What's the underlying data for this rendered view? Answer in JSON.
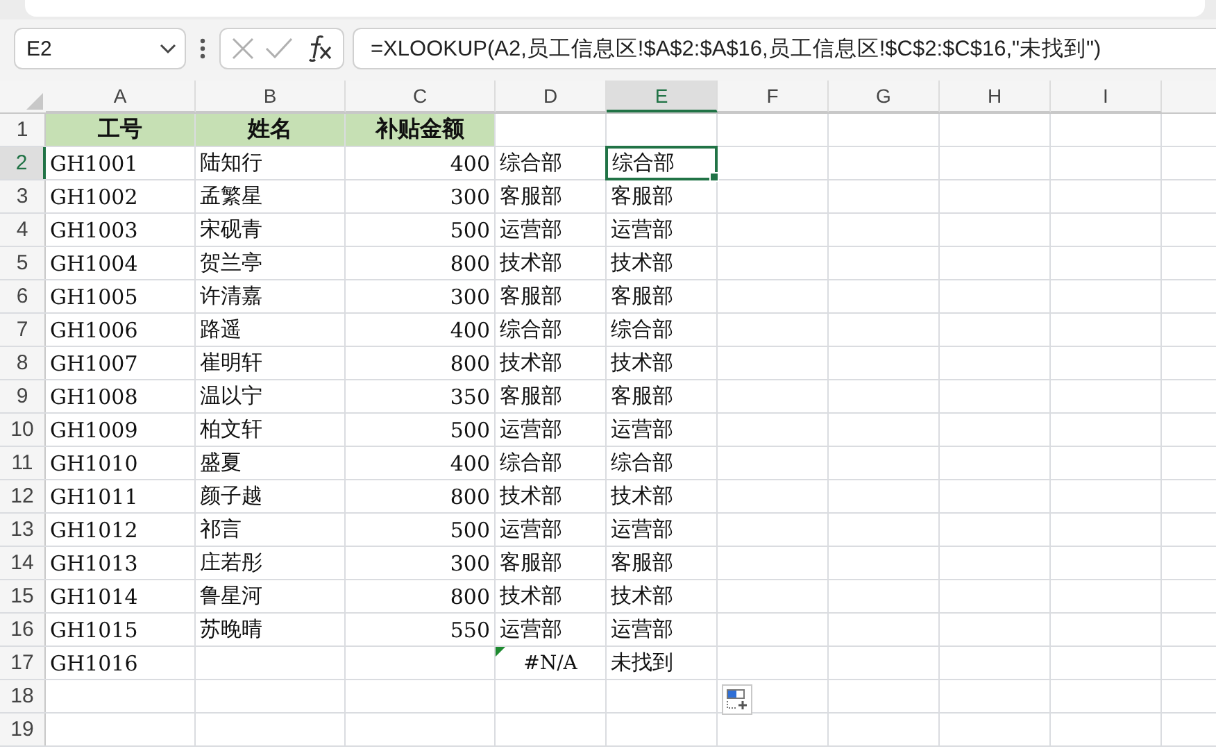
{
  "name_box": "E2",
  "formula": "=XLOOKUP(A2,员工信息区!$A$2:$A$16,员工信息区!$C$2:$C$16,\"未找到\")",
  "columns": [
    {
      "label": "A",
      "selected": false
    },
    {
      "label": "B",
      "selected": false
    },
    {
      "label": "C",
      "selected": false
    },
    {
      "label": "D",
      "selected": false
    },
    {
      "label": "E",
      "selected": true
    },
    {
      "label": "F",
      "selected": false
    },
    {
      "label": "G",
      "selected": false
    },
    {
      "label": "H",
      "selected": false
    },
    {
      "label": "I",
      "selected": false
    }
  ],
  "rows": [
    {
      "label": "1",
      "selected": false,
      "cells": [
        {
          "text": "工号",
          "kind": "header",
          "selected": false
        },
        {
          "text": "姓名",
          "kind": "header",
          "selected": false
        },
        {
          "text": "补贴金额",
          "kind": "header",
          "selected": false
        },
        null,
        null
      ]
    },
    {
      "label": "2",
      "selected": true,
      "cells": [
        {
          "text": "GH1001",
          "kind": "text",
          "selected": false
        },
        {
          "text": "陆知行",
          "kind": "text",
          "selected": false
        },
        {
          "text": "400",
          "kind": "number",
          "selected": false
        },
        {
          "text": "综合部",
          "kind": "text",
          "selected": false
        },
        {
          "text": "综合部",
          "kind": "text",
          "selected": true
        }
      ]
    },
    {
      "label": "3",
      "selected": false,
      "cells": [
        {
          "text": "GH1002",
          "kind": "text",
          "selected": false
        },
        {
          "text": "孟繁星",
          "kind": "text",
          "selected": false
        },
        {
          "text": "300",
          "kind": "number",
          "selected": false
        },
        {
          "text": "客服部",
          "kind": "text",
          "selected": false
        },
        {
          "text": "客服部",
          "kind": "text",
          "selected": false
        }
      ]
    },
    {
      "label": "4",
      "selected": false,
      "cells": [
        {
          "text": "GH1003",
          "kind": "text",
          "selected": false
        },
        {
          "text": "宋砚青",
          "kind": "text",
          "selected": false
        },
        {
          "text": "500",
          "kind": "number",
          "selected": false
        },
        {
          "text": "运营部",
          "kind": "text",
          "selected": false
        },
        {
          "text": "运营部",
          "kind": "text",
          "selected": false
        }
      ]
    },
    {
      "label": "5",
      "selected": false,
      "cells": [
        {
          "text": "GH1004",
          "kind": "text",
          "selected": false
        },
        {
          "text": "贺兰亭",
          "kind": "text",
          "selected": false
        },
        {
          "text": "800",
          "kind": "number",
          "selected": false
        },
        {
          "text": "技术部",
          "kind": "text",
          "selected": false
        },
        {
          "text": "技术部",
          "kind": "text",
          "selected": false
        }
      ]
    },
    {
      "label": "6",
      "selected": false,
      "cells": [
        {
          "text": "GH1005",
          "kind": "text",
          "selected": false
        },
        {
          "text": "许清嘉",
          "kind": "text",
          "selected": false
        },
        {
          "text": "300",
          "kind": "number",
          "selected": false
        },
        {
          "text": "客服部",
          "kind": "text",
          "selected": false
        },
        {
          "text": "客服部",
          "kind": "text",
          "selected": false
        }
      ]
    },
    {
      "label": "7",
      "selected": false,
      "cells": [
        {
          "text": "GH1006",
          "kind": "text",
          "selected": false
        },
        {
          "text": "路遥",
          "kind": "text",
          "selected": false
        },
        {
          "text": "400",
          "kind": "number",
          "selected": false
        },
        {
          "text": "综合部",
          "kind": "text",
          "selected": false
        },
        {
          "text": "综合部",
          "kind": "text",
          "selected": false
        }
      ]
    },
    {
      "label": "8",
      "selected": false,
      "cells": [
        {
          "text": "GH1007",
          "kind": "text",
          "selected": false
        },
        {
          "text": "崔明轩",
          "kind": "text",
          "selected": false
        },
        {
          "text": "800",
          "kind": "number",
          "selected": false
        },
        {
          "text": "技术部",
          "kind": "text",
          "selected": false
        },
        {
          "text": "技术部",
          "kind": "text",
          "selected": false
        }
      ]
    },
    {
      "label": "9",
      "selected": false,
      "cells": [
        {
          "text": "GH1008",
          "kind": "text",
          "selected": false
        },
        {
          "text": "温以宁",
          "kind": "text",
          "selected": false
        },
        {
          "text": "350",
          "kind": "number",
          "selected": false
        },
        {
          "text": "客服部",
          "kind": "text",
          "selected": false
        },
        {
          "text": "客服部",
          "kind": "text",
          "selected": false
        }
      ]
    },
    {
      "label": "10",
      "selected": false,
      "cells": [
        {
          "text": "GH1009",
          "kind": "text",
          "selected": false
        },
        {
          "text": "柏文轩",
          "kind": "text",
          "selected": false
        },
        {
          "text": "500",
          "kind": "number",
          "selected": false
        },
        {
          "text": "运营部",
          "kind": "text",
          "selected": false
        },
        {
          "text": "运营部",
          "kind": "text",
          "selected": false
        }
      ]
    },
    {
      "label": "11",
      "selected": false,
      "cells": [
        {
          "text": "GH1010",
          "kind": "text",
          "selected": false
        },
        {
          "text": "盛夏",
          "kind": "text",
          "selected": false
        },
        {
          "text": "400",
          "kind": "number",
          "selected": false
        },
        {
          "text": "综合部",
          "kind": "text",
          "selected": false
        },
        {
          "text": "综合部",
          "kind": "text",
          "selected": false
        }
      ]
    },
    {
      "label": "12",
      "selected": false,
      "cells": [
        {
          "text": "GH1011",
          "kind": "text",
          "selected": false
        },
        {
          "text": "颜子越",
          "kind": "text",
          "selected": false
        },
        {
          "text": "800",
          "kind": "number",
          "selected": false
        },
        {
          "text": "技术部",
          "kind": "text",
          "selected": false
        },
        {
          "text": "技术部",
          "kind": "text",
          "selected": false
        }
      ]
    },
    {
      "label": "13",
      "selected": false,
      "cells": [
        {
          "text": "GH1012",
          "kind": "text",
          "selected": false
        },
        {
          "text": "祁言",
          "kind": "text",
          "selected": false
        },
        {
          "text": "500",
          "kind": "number",
          "selected": false
        },
        {
          "text": "运营部",
          "kind": "text",
          "selected": false
        },
        {
          "text": "运营部",
          "kind": "text",
          "selected": false
        }
      ]
    },
    {
      "label": "14",
      "selected": false,
      "cells": [
        {
          "text": "GH1013",
          "kind": "text",
          "selected": false
        },
        {
          "text": "庄若彤",
          "kind": "text",
          "selected": false
        },
        {
          "text": "300",
          "kind": "number",
          "selected": false
        },
        {
          "text": "客服部",
          "kind": "text",
          "selected": false
        },
        {
          "text": "客服部",
          "kind": "text",
          "selected": false
        }
      ]
    },
    {
      "label": "15",
      "selected": false,
      "cells": [
        {
          "text": "GH1014",
          "kind": "text",
          "selected": false
        },
        {
          "text": "鲁星河",
          "kind": "text",
          "selected": false
        },
        {
          "text": "800",
          "kind": "number",
          "selected": false
        },
        {
          "text": "技术部",
          "kind": "text",
          "selected": false
        },
        {
          "text": "技术部",
          "kind": "text",
          "selected": false
        }
      ]
    },
    {
      "label": "16",
      "selected": false,
      "cells": [
        {
          "text": "GH1015",
          "kind": "text",
          "selected": false
        },
        {
          "text": "苏晚晴",
          "kind": "text",
          "selected": false
        },
        {
          "text": "550",
          "kind": "number",
          "selected": false
        },
        {
          "text": "运营部",
          "kind": "text",
          "selected": false
        },
        {
          "text": "运营部",
          "kind": "text",
          "selected": false
        }
      ]
    },
    {
      "label": "17",
      "selected": false,
      "cells": [
        {
          "text": "GH1016",
          "kind": "text",
          "selected": false
        },
        null,
        null,
        {
          "text": "#N/A",
          "kind": "error",
          "selected": false
        },
        {
          "text": "未找到",
          "kind": "text",
          "selected": false
        }
      ]
    },
    {
      "label": "18",
      "selected": false,
      "cells": [
        null,
        null,
        null,
        null,
        null
      ]
    },
    {
      "label": "19",
      "selected": false,
      "cells": [
        null,
        null,
        null,
        null,
        null
      ]
    }
  ]
}
